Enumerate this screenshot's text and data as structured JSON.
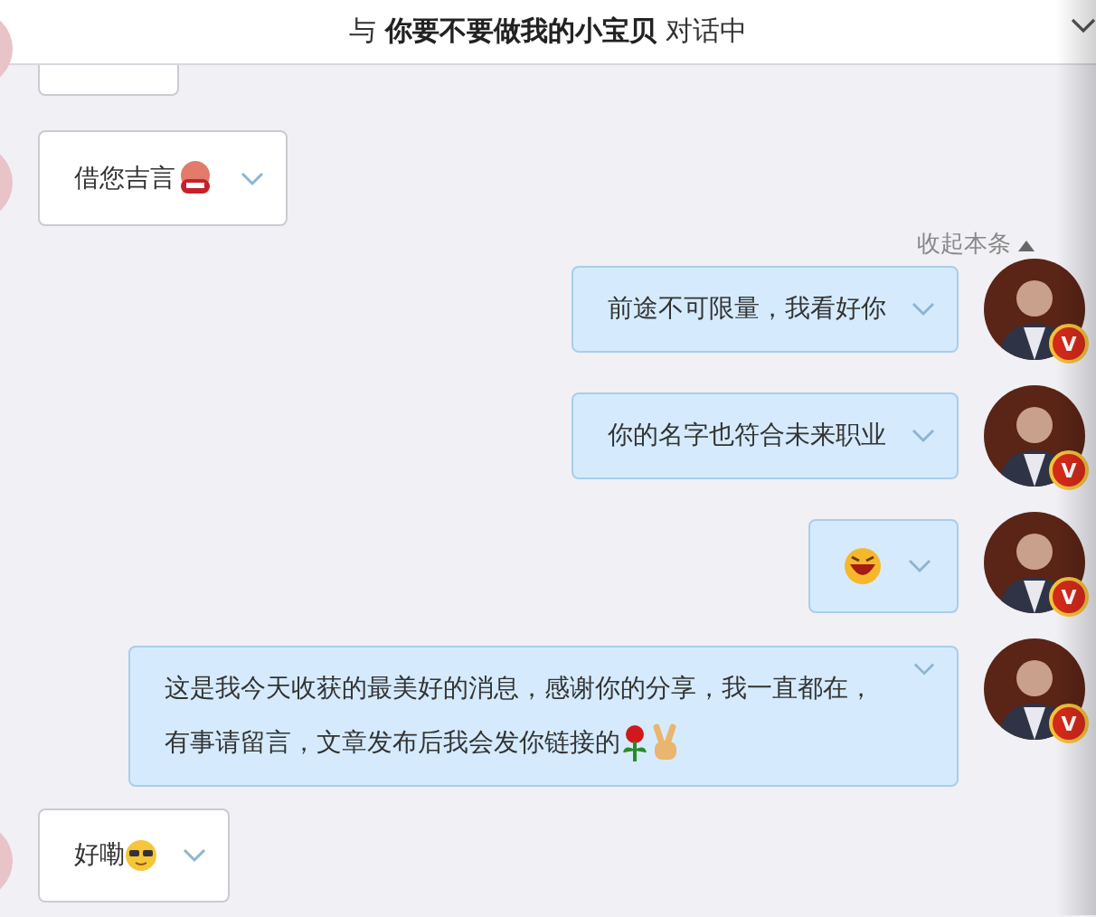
{
  "header": {
    "title": "与 **你要不要做我的小宝贝** 对话中"
  },
  "messages": [
    {
      "outgoing": false,
      "kind": "partial"
    },
    {
      "outgoing": false,
      "kind": "text",
      "text": "借您吉言"
    },
    {
      "outgoing": true,
      "kind": "text",
      "text": "前途不可限量，我看好你",
      "collapse_label": "收起本条",
      "badge": "V"
    },
    {
      "outgoing": true,
      "kind": "text",
      "text": "你的名字也符合未来职业",
      "badge": "V"
    },
    {
      "outgoing": true,
      "kind": "emoji",
      "badge": "V"
    },
    {
      "outgoing": true,
      "kind": "text",
      "text": "这是我今天收获的最美好的消息，感谢你的分享，我一直都在，有事请留言，文章发布后我会发你链接的",
      "badge": "V"
    },
    {
      "outgoing": false,
      "kind": "text",
      "text": "好嘞"
    }
  ]
}
